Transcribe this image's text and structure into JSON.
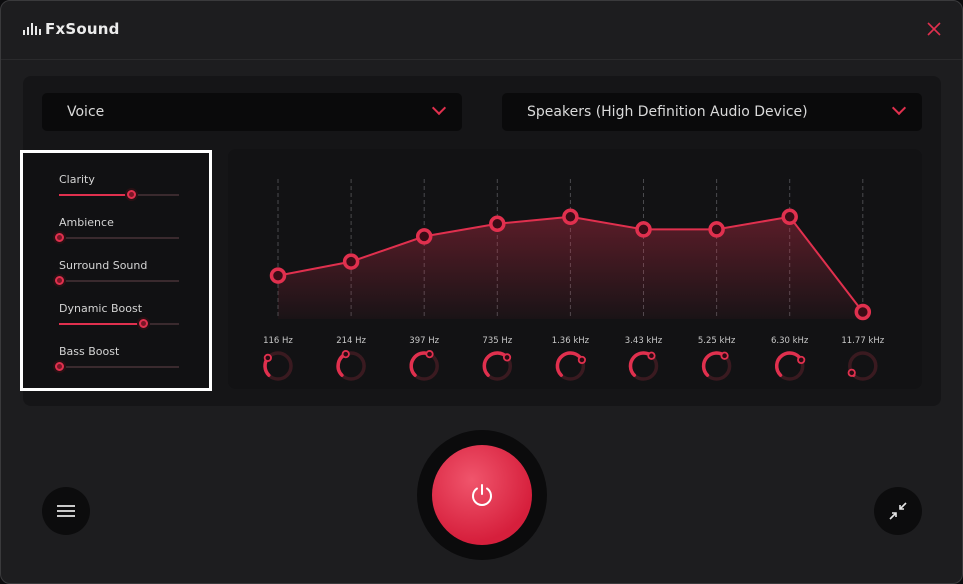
{
  "app": {
    "title": "FxSound"
  },
  "preset": {
    "selected": "Voice"
  },
  "output_device": {
    "selected": "Speakers (High Definition Audio Device)"
  },
  "effects": [
    {
      "name": "Clarity",
      "value": 0.6
    },
    {
      "name": "Ambience",
      "value": 0.0
    },
    {
      "name": "Surround Sound",
      "value": 0.0
    },
    {
      "name": "Dynamic Boost",
      "value": 0.7
    },
    {
      "name": "Bass Boost",
      "value": 0.0
    }
  ],
  "equalizer": {
    "bands": [
      {
        "freq": "116 Hz",
        "level": 0.31
      },
      {
        "freq": "214 Hz",
        "level": 0.41
      },
      {
        "freq": "397 Hz",
        "level": 0.59
      },
      {
        "freq": "735 Hz",
        "level": 0.68
      },
      {
        "freq": "1.36 kHz",
        "level": 0.73
      },
      {
        "freq": "3.43 kHz",
        "level": 0.64
      },
      {
        "freq": "5.25 kHz",
        "level": 0.64
      },
      {
        "freq": "6.30 kHz",
        "level": 0.73
      },
      {
        "freq": "11.77 kHz",
        "level": 0.05
      }
    ]
  },
  "colors": {
    "accent": "#e0304e",
    "background": "#1d1d1f",
    "panel": "#151517"
  },
  "icons": {
    "close": "close-icon",
    "menu": "menu-icon",
    "power": "power-icon",
    "compact": "compact-view-icon",
    "chevron": "chevron-down-icon"
  }
}
